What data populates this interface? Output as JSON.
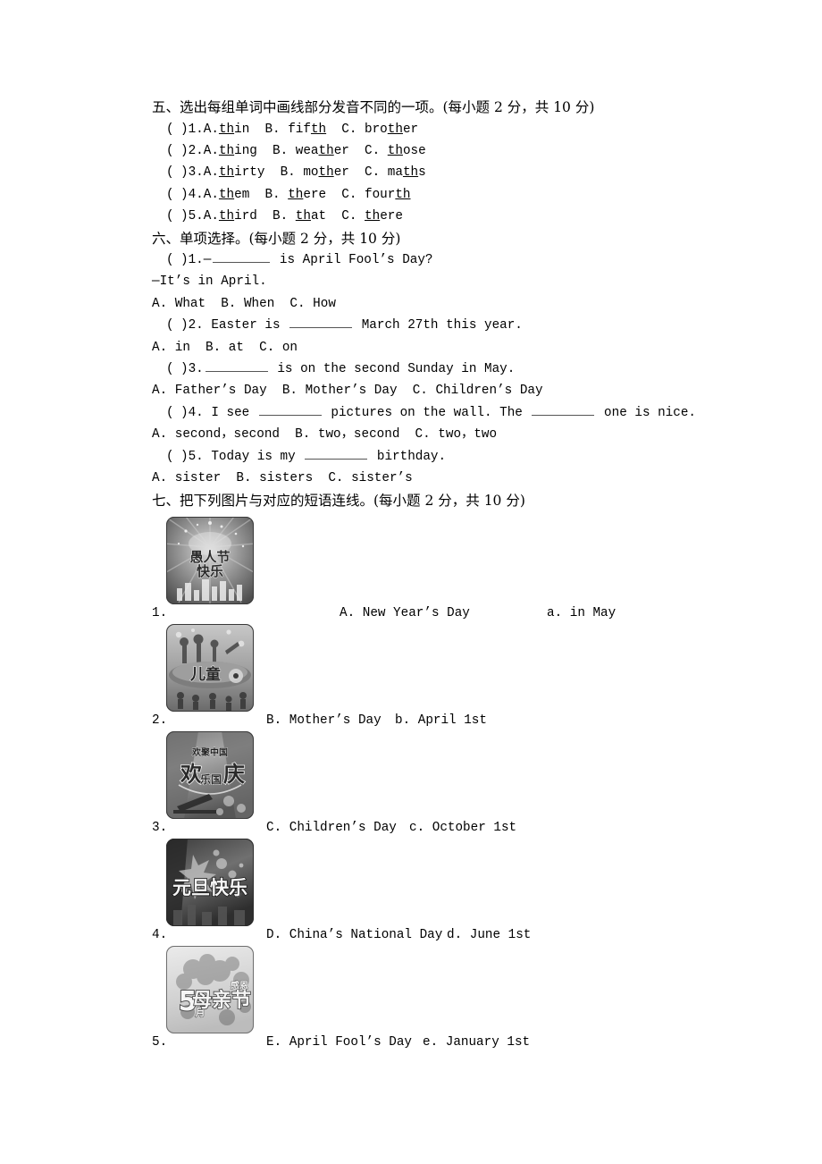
{
  "sections": [
    {
      "id": "section-five",
      "heading": "五、选出每组单词中画线部分发音不同的一项。(每小题 2 分，共 10 分)",
      "items": [
        {
          "num": "1.",
          "a_pre": "",
          "a_u": "th",
          "a_post": "in",
          "b_pre": "fif",
          "b_u": "th",
          "b_post": "",
          "c_pre": "bro",
          "c_u": "th",
          "c_post": "er"
        },
        {
          "num": "2.",
          "a_pre": "",
          "a_u": "th",
          "a_post": "ing",
          "b_pre": "wea",
          "b_u": "th",
          "b_post": "er",
          "c_pre": "",
          "c_u": "th",
          "c_post": "ose"
        },
        {
          "num": "3.",
          "a_pre": "",
          "a_u": "th",
          "a_post": "irty",
          "b_pre": "mo",
          "b_u": "th",
          "b_post": "er",
          "c_pre": "ma",
          "c_u": "th",
          "c_post": "s"
        },
        {
          "num": "4.",
          "a_pre": "",
          "a_u": "th",
          "a_post": "em",
          "b_pre": "",
          "b_u": "th",
          "b_post": "ere",
          "c_pre": "four",
          "c_u": "th",
          "c_post": ""
        },
        {
          "num": "5.",
          "a_pre": "",
          "a_u": "th",
          "a_post": "ird",
          "b_pre": "",
          "b_u": "th",
          "b_post": "at",
          "c_pre": "",
          "c_u": "th",
          "c_post": "ere"
        }
      ]
    }
  ],
  "section_six": {
    "heading": "六、单项选择。(每小题 2 分，共 10 分)",
    "q1_stem_a": "1.—",
    "q1_stem_b": " is April Fool’s Day?",
    "q1_line2": "—It’s in April.",
    "q1_options": "A. What  B. When  C. How",
    "q2_stem_a": "2. Easter is ",
    "q2_stem_b": " March 27th this year.",
    "q2_options": "A. in  B. at  C. on",
    "q3_stem_a": "3.",
    "q3_stem_b": " is on the second Sunday in May.",
    "q3_options": "A. Father’s Day  B. Mother’s Day  C. Children’s Day",
    "q4_stem_a": "4. I see ",
    "q4_stem_b": " pictures on the wall. The ",
    "q4_stem_c": " one is nice.",
    "q4_options": "A. second，second  B. two，second  C. two，two",
    "q5_stem_a": "5. Today is my ",
    "q5_stem_b": " birthday.",
    "q5_options": "A. sister  B. sisters  C. sister’s"
  },
  "section_seven": {
    "heading": "七、把下列图片与对应的短语连线。(每小题 2 分，共 10 分)",
    "rows": [
      {
        "num": "1.",
        "image_name": "april-fools-day-poster",
        "image_caption": "愚人节快乐",
        "major": "A. New Year’s Day",
        "minor": "a. in May"
      },
      {
        "num": "2.",
        "image_name": "childrens-day-poster",
        "image_caption": "儿童节",
        "major": "B. Mother’s Day",
        "minor": "b. April 1st"
      },
      {
        "num": "3.",
        "image_name": "national-day-poster",
        "image_caption": "欢乐国庆",
        "major": "C. Children’s Day",
        "minor": "c. October 1st"
      },
      {
        "num": "4.",
        "image_name": "new-year-day-poster",
        "image_caption": "元旦快乐",
        "major": "D. China’s National Day",
        "minor": "d. June 1st"
      },
      {
        "num": "5.",
        "image_name": "mothers-day-poster",
        "image_caption": "5月母亲节感恩",
        "major": "E. April Fool’s Day",
        "minor": "e. January 1st"
      }
    ]
  }
}
